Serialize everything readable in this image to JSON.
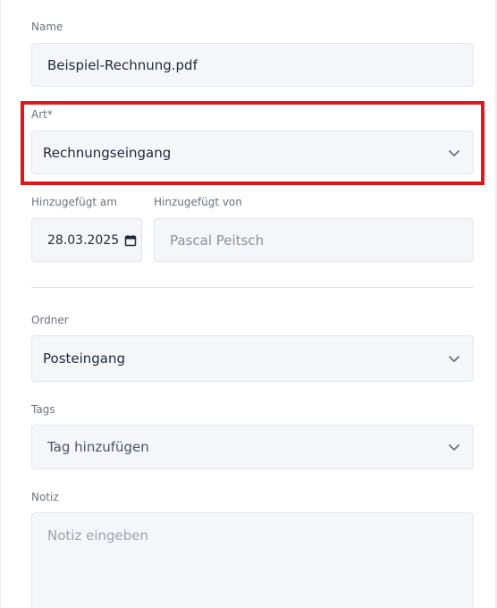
{
  "form": {
    "name": {
      "label": "Name",
      "value": "Beispiel-Rechnung.pdf"
    },
    "art": {
      "label": "Art*",
      "value": "Rechnungseingang"
    },
    "added_on": {
      "label": "Hinzugefügt am",
      "value": "28.03.2025"
    },
    "added_by": {
      "label": "Hinzugefügt von",
      "value": "Pascal Peitsch"
    },
    "folder": {
      "label": "Ordner",
      "value": "Posteingang"
    },
    "tags": {
      "label": "Tags",
      "placeholder": "Tag hinzufügen"
    },
    "note": {
      "label": "Notiz",
      "placeholder": "Notiz eingeben"
    }
  },
  "colors": {
    "highlight": "#e0161b",
    "field_bg": "#f5f6f9",
    "field_border": "#e2e5eb",
    "label": "#6b7280"
  },
  "icons": {
    "select_chevron": "chevron-down-icon",
    "date": "calendar-icon"
  }
}
